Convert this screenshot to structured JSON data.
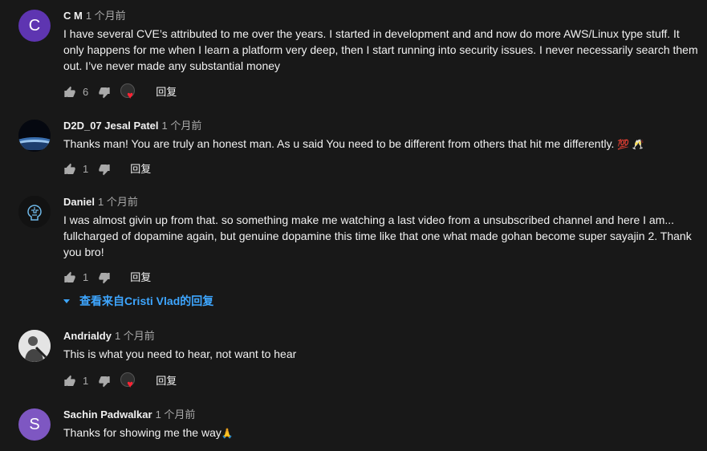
{
  "comments": [
    {
      "author": "C M",
      "time": "1 个月前",
      "avatar_letter": "C",
      "text": "I have several CVE’s attributed to me over the years. I started in development and and now do more AWS/Linux type stuff. It only happens for me when I learn a platform very deep, then I start running into security issues. I never necessarily search them out. I’ve never made any substantial money",
      "likes": "6",
      "reply_label": "回复"
    },
    {
      "author": "D2D_07 Jesal Patel",
      "time": "1 个月前",
      "text": "Thanks man! You are truly an honest man. As u said You need to be different from others that hit me differently.",
      "emoji": "💯 🥂",
      "likes": "1",
      "reply_label": "回复"
    },
    {
      "author": "Daniel",
      "time": "1 个月前",
      "text": "I was almost givin up from that. so something  make me watching a last video from a unsubscribed channel and here I am... fullcharged of dopamine again, but genuine dopamine this time like that one what made gohan become super sayajin 2. Thank you bro!",
      "likes": "1",
      "reply_label": "回复",
      "view_replies": "查看来自Cristi Vlad的回复"
    },
    {
      "author": "Andrialdy",
      "time": "1 个月前",
      "text": "This is what you need to hear, not want to hear",
      "likes": "1",
      "reply_label": "回复"
    },
    {
      "author": "Sachin Padwalkar",
      "time": "1 个月前",
      "avatar_letter": "S",
      "text": "Thanks for showing me the way",
      "emoji": "🙏"
    }
  ],
  "colors": {
    "background": "#181818",
    "text": "#f1f1f1",
    "secondary": "#aaaaaa",
    "link": "#3ea6ff",
    "heart": "#ff2233"
  },
  "icons": [
    "thumb-up-icon",
    "thumb-down-icon",
    "creator-heart-icon",
    "chevron-down-icon"
  ]
}
